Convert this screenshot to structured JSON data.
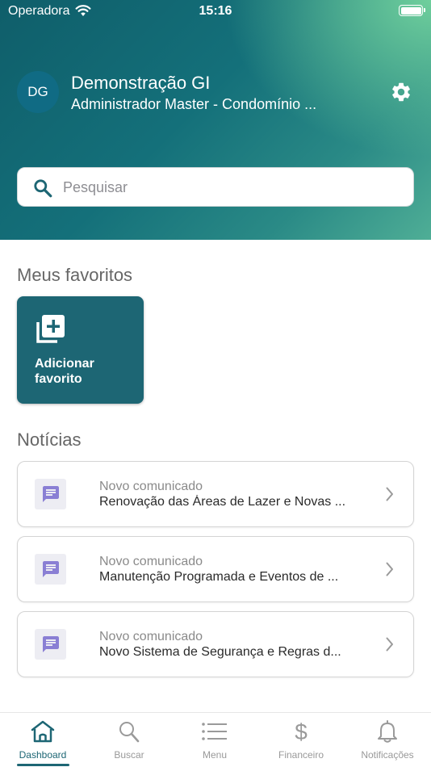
{
  "status_bar": {
    "carrier": "Operadora",
    "time": "15:16"
  },
  "header": {
    "avatar_initials": "DG",
    "user_name": "Demonstração GI",
    "user_role": "Administrador Master - Condomínio ..."
  },
  "search": {
    "placeholder": "Pesquisar"
  },
  "favorites": {
    "title": "Meus favoritos",
    "add_label": "Adicionar favorito"
  },
  "news": {
    "title": "Notícias",
    "items": [
      {
        "kind": "Novo comunicado",
        "title": "Renovação das Áreas de Lazer e Novas ..."
      },
      {
        "kind": "Novo comunicado",
        "title": "Manutenção Programada e Eventos de ..."
      },
      {
        "kind": "Novo comunicado",
        "title": "Novo Sistema de Segurança e Regras d..."
      }
    ]
  },
  "tabbar": {
    "tabs": [
      {
        "label": "Dashboard",
        "icon": "home-icon",
        "active": true
      },
      {
        "label": "Buscar",
        "icon": "search-icon"
      },
      {
        "label": "Menu",
        "icon": "menu-icon"
      },
      {
        "label": "Financeiro",
        "icon": "dollar-icon"
      },
      {
        "label": "Notificações",
        "icon": "bell-icon"
      }
    ]
  },
  "colors": {
    "primary": "#1d6674",
    "header_gradient_start": "#0f5e6a",
    "header_gradient_end": "#6fcf9c",
    "news_icon": "#8a7fd4"
  }
}
